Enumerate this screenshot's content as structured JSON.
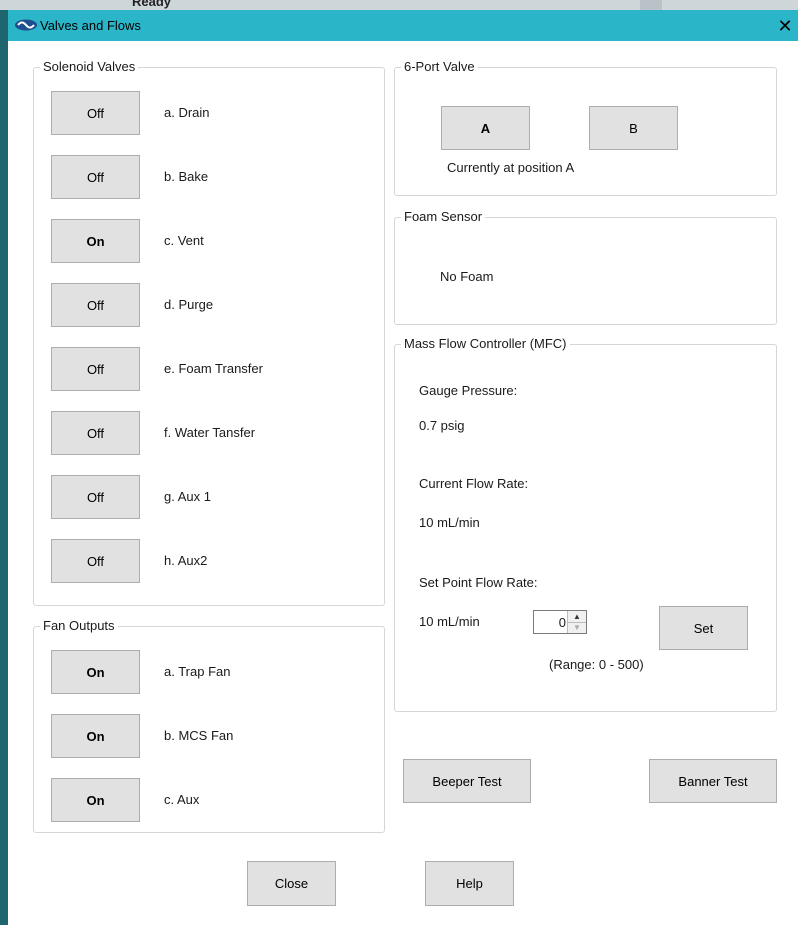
{
  "background": {
    "partial_text": "Ready"
  },
  "window": {
    "title": "Valves and Flows",
    "close_symbol": "✕"
  },
  "solenoid": {
    "title": "Solenoid Valves",
    "items": [
      {
        "state": "Off",
        "label": "a. Drain"
      },
      {
        "state": "Off",
        "label": "b. Bake"
      },
      {
        "state": "On",
        "label": "c. Vent"
      },
      {
        "state": "Off",
        "label": "d. Purge"
      },
      {
        "state": "Off",
        "label": "e. Foam Transfer"
      },
      {
        "state": "Off",
        "label": "f. Water Tansfer"
      },
      {
        "state": "Off",
        "label": "g. Aux 1"
      },
      {
        "state": "Off",
        "label": "h. Aux2"
      }
    ]
  },
  "fans": {
    "title": "Fan Outputs",
    "items": [
      {
        "state": "On",
        "label": "a. Trap Fan"
      },
      {
        "state": "On",
        "label": "b. MCS Fan"
      },
      {
        "state": "On",
        "label": "c. Aux"
      }
    ]
  },
  "six_port": {
    "title": "6-Port Valve",
    "button_a": "A",
    "button_b": "B",
    "status": "Currently at position A"
  },
  "foam": {
    "title": "Foam Sensor",
    "status": "No Foam"
  },
  "mfc": {
    "title": "Mass Flow Controller (MFC)",
    "gauge_label": "Gauge Pressure:",
    "gauge_value": "0.7 psig",
    "flow_label": "Current Flow Rate:",
    "flow_value": "10 mL/min",
    "setpoint_label": "Set Point Flow Rate:",
    "setpoint_value": "10 mL/min",
    "spin_value": "0",
    "set_button": "Set",
    "range": "(Range: 0 - 500)"
  },
  "actions": {
    "beeper": "Beeper Test",
    "banner": "Banner Test",
    "close": "Close",
    "help": "Help"
  },
  "colors": {
    "titlebar": "#2bb5c8",
    "button": "#e1e1e1",
    "border": "#d6d6d6"
  }
}
